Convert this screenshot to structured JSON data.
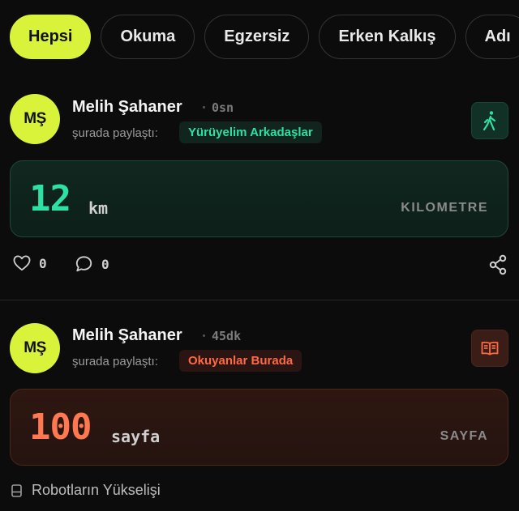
{
  "filters": [
    {
      "label": "Hepsi",
      "active": true
    },
    {
      "label": "Okuma",
      "active": false
    },
    {
      "label": "Egzersiz",
      "active": false
    },
    {
      "label": "Erken Kalkış",
      "active": false
    },
    {
      "label": "Adı",
      "active": false
    }
  ],
  "posts": [
    {
      "avatar_initials": "MŞ",
      "user_name": "Melih Şahaner",
      "time": "0sn",
      "shared_in_text": "şurada paylaştı:",
      "group_name": "Yürüyelim Arkadaşlar",
      "type_icon": "walking-icon",
      "accent": "#2ee0a4",
      "metric_value": "12",
      "metric_unit": "km",
      "metric_label": "KILOMETRE",
      "likes": "0",
      "comments": "0"
    },
    {
      "avatar_initials": "MŞ",
      "user_name": "Melih Şahaner",
      "time": "45dk",
      "shared_in_text": "şurada paylaştı:",
      "group_name": "Okuyanlar Burada",
      "type_icon": "book-icon",
      "accent": "#ff6a45",
      "metric_value": "100",
      "metric_unit": "sayfa",
      "metric_label": "SAYFA",
      "book_title": "Robotların Yükselişi"
    }
  ],
  "colors": {
    "brand": "#d8f33a",
    "background": "#0c0c0c"
  }
}
